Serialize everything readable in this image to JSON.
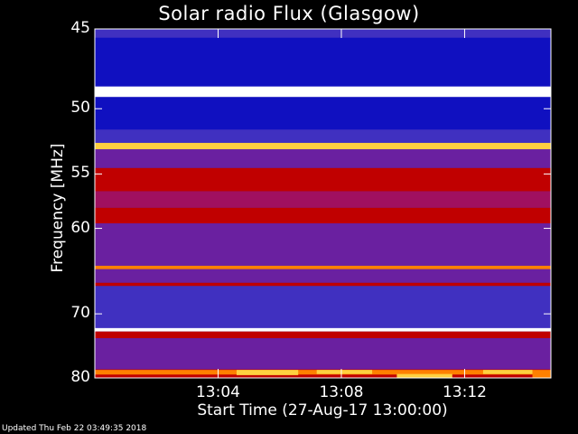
{
  "chart_data": {
    "type": "heatmap",
    "title": "Solar radio Flux (Glasgow)",
    "xlabel": "Start Time (27-Aug-17 13:00:00)",
    "ylabel": "Frequency [MHz]",
    "x_ticks": [
      "13:04",
      "13:08",
      "13:12"
    ],
    "x_tick_minutes": [
      4,
      8,
      12
    ],
    "x_range_minutes": [
      0,
      14.8
    ],
    "y_ticks": [
      "45",
      "50",
      "55",
      "60",
      "70",
      "80"
    ],
    "y_tick_values": [
      45,
      50,
      55,
      60,
      70,
      80
    ],
    "y_range": [
      45,
      80
    ],
    "y_scale": "reciprocal",
    "grid": false,
    "colormap": [
      "#000000",
      "#1010c0",
      "#4030c0",
      "#6a20a0",
      "#a01060",
      "#c00000",
      "#e04000",
      "#ff8000",
      "#ffd040",
      "#ffffff"
    ],
    "background_color": "#000000",
    "bands": [
      {
        "f0": 45.0,
        "f1": 45.5,
        "level": 2
      },
      {
        "f0": 45.5,
        "f1": 48.5,
        "level": 1
      },
      {
        "f0": 48.5,
        "f1": 49.2,
        "level": 9
      },
      {
        "f0": 49.2,
        "f1": 51.5,
        "level": 1
      },
      {
        "f0": 51.5,
        "f1": 52.5,
        "level": 2
      },
      {
        "f0": 52.5,
        "f1": 53.0,
        "level": 8
      },
      {
        "f0": 53.0,
        "f1": 54.5,
        "level": 3
      },
      {
        "f0": 54.5,
        "f1": 56.5,
        "level": 5
      },
      {
        "f0": 56.5,
        "f1": 58.0,
        "level": 4
      },
      {
        "f0": 58.0,
        "f1": 59.5,
        "level": 5
      },
      {
        "f0": 59.5,
        "f1": 64.0,
        "level": 3
      },
      {
        "f0": 64.0,
        "f1": 64.4,
        "level": 7
      },
      {
        "f0": 64.4,
        "f1": 66.0,
        "level": 3
      },
      {
        "f0": 66.0,
        "f1": 66.4,
        "level": 5
      },
      {
        "f0": 66.4,
        "f1": 72.0,
        "level": 2
      },
      {
        "f0": 72.0,
        "f1": 72.5,
        "level": 9
      },
      {
        "f0": 72.5,
        "f1": 73.5,
        "level": 5
      },
      {
        "f0": 73.5,
        "f1": 78.5,
        "level": 3
      },
      {
        "f0": 78.5,
        "f1": 80.0,
        "level": 5
      }
    ],
    "bursts": [
      {
        "t0": 0.0,
        "t1": 14.8,
        "f0": 78.6,
        "f1": 79.4,
        "level": 7
      },
      {
        "t0": 4.6,
        "t1": 6.6,
        "f0": 78.6,
        "f1": 79.5,
        "level": 8
      },
      {
        "t0": 7.2,
        "t1": 9.0,
        "f0": 78.6,
        "f1": 79.3,
        "level": 8
      },
      {
        "t0": 9.8,
        "t1": 11.6,
        "f0": 79.3,
        "f1": 80.0,
        "level": 8
      },
      {
        "t0": 12.6,
        "t1": 14.2,
        "f0": 78.6,
        "f1": 79.3,
        "level": 8
      },
      {
        "t0": 14.2,
        "t1": 14.8,
        "f0": 79.0,
        "f1": 80.0,
        "level": 7
      }
    ]
  },
  "footer": "Updated Thu Feb 22 03:49:35 2018"
}
